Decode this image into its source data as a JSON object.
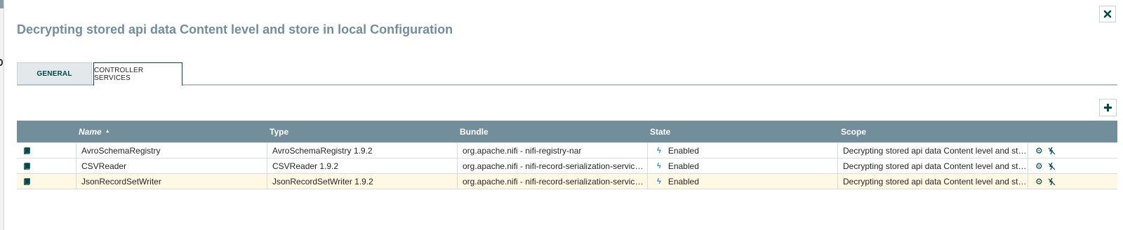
{
  "dialog": {
    "title": "Decrypting stored api data Content level and store in local Configuration",
    "close_icon": "close-icon",
    "add_icon": "plus-icon"
  },
  "tabs": [
    {
      "label": "GENERAL",
      "active": false
    },
    {
      "label": "CONTROLLER SERVICES",
      "active": true
    }
  ],
  "grid": {
    "columns": {
      "name": "Name",
      "sort_indicator": "▲",
      "type": "Type",
      "bundle": "Bundle",
      "state": "State",
      "scope": "Scope"
    },
    "rows": [
      {
        "icon": "book-icon",
        "name": "AvroSchemaRegistry",
        "type": "AvroSchemaRegistry 1.9.2",
        "bundle": "org.apache.nifi - nifi-registry-nar",
        "state_icon": "bolt-icon",
        "state": "Enabled",
        "scope": "Decrypting stored api data Content level and stor...",
        "selected": false
      },
      {
        "icon": "book-icon",
        "name": "CSVReader",
        "type": "CSVReader 1.9.2",
        "bundle": "org.apache.nifi - nifi-record-serialization-services-...",
        "state_icon": "bolt-icon",
        "state": "Enabled",
        "scope": "Decrypting stored api data Content level and stor...",
        "selected": false
      },
      {
        "icon": "book-icon",
        "name": "JsonRecordSetWriter",
        "type": "JsonRecordSetWriter 1.9.2",
        "bundle": "org.apache.nifi - nifi-record-serialization-services-...",
        "state_icon": "bolt-icon",
        "state": "Enabled",
        "scope": "Decrypting stored api data Content level and stor...",
        "selected": true
      }
    ]
  },
  "colors": {
    "header_bg": "#728e9b",
    "title": "#728e9b",
    "selected_row": "#fff9e4",
    "enabled_bolt": "#1a8fd9",
    "accent": "#004849"
  }
}
